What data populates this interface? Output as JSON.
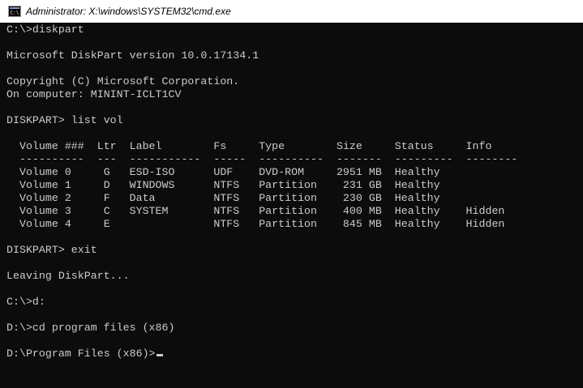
{
  "window": {
    "title": "Administrator: X:\\windows\\SYSTEM32\\cmd.exe",
    "icon": "cmd-console-icon",
    "colors": {
      "background": "#0c0c0c",
      "text": "#cccccc",
      "titlebar": "#ffffff"
    }
  },
  "console": {
    "lines": [
      "C:\\>diskpart",
      "",
      "Microsoft DiskPart version 10.0.17134.1",
      "",
      "Copyright (C) Microsoft Corporation.",
      "On computer: MININT-ICLT1CV",
      "",
      "DISKPART> list vol",
      "",
      "  Volume ###  Ltr  Label        Fs     Type        Size     Status     Info",
      "  ----------  ---  -----------  -----  ----------  -------  ---------  --------",
      "  Volume 0     G   ESD-ISO      UDF    DVD-ROM     2951 MB  Healthy",
      "  Volume 1     D   WINDOWS      NTFS   Partition    231 GB  Healthy",
      "  Volume 2     F   Data         NTFS   Partition    230 GB  Healthy",
      "  Volume 3     C   SYSTEM       NTFS   Partition    400 MB  Healthy    Hidden",
      "  Volume 4     E                NTFS   Partition    845 MB  Healthy    Hidden",
      "",
      "DISKPART> exit",
      "",
      "Leaving DiskPart...",
      "",
      "C:\\>d:",
      "",
      "D:\\>cd program files (x86)",
      "",
      "D:\\Program Files (x86)>"
    ]
  }
}
